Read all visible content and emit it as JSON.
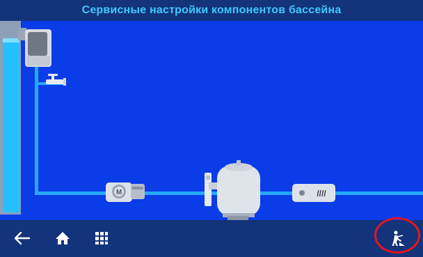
{
  "window": {
    "title": "Сервисные настройки компонентов бассейна"
  },
  "scene": {
    "components": [
      {
        "name": "pool-tank"
      },
      {
        "name": "skimmer"
      },
      {
        "name": "tap-valve"
      },
      {
        "name": "pump",
        "label": "M"
      },
      {
        "name": "sand-filter"
      },
      {
        "name": "heater",
        "label": "////"
      }
    ]
  },
  "toolbar": {
    "back_icon": "arrow-left-icon",
    "home_icon": "home-icon",
    "menu_icon": "grid-menu-icon",
    "service_icon": "worker-service-icon"
  },
  "colors": {
    "title_bg": "#13337a",
    "title_text": "#3ec8ff",
    "scene_bg": "#0a3ce8",
    "pipe": "#27a8ff",
    "highlight_ring": "#e8141e"
  }
}
